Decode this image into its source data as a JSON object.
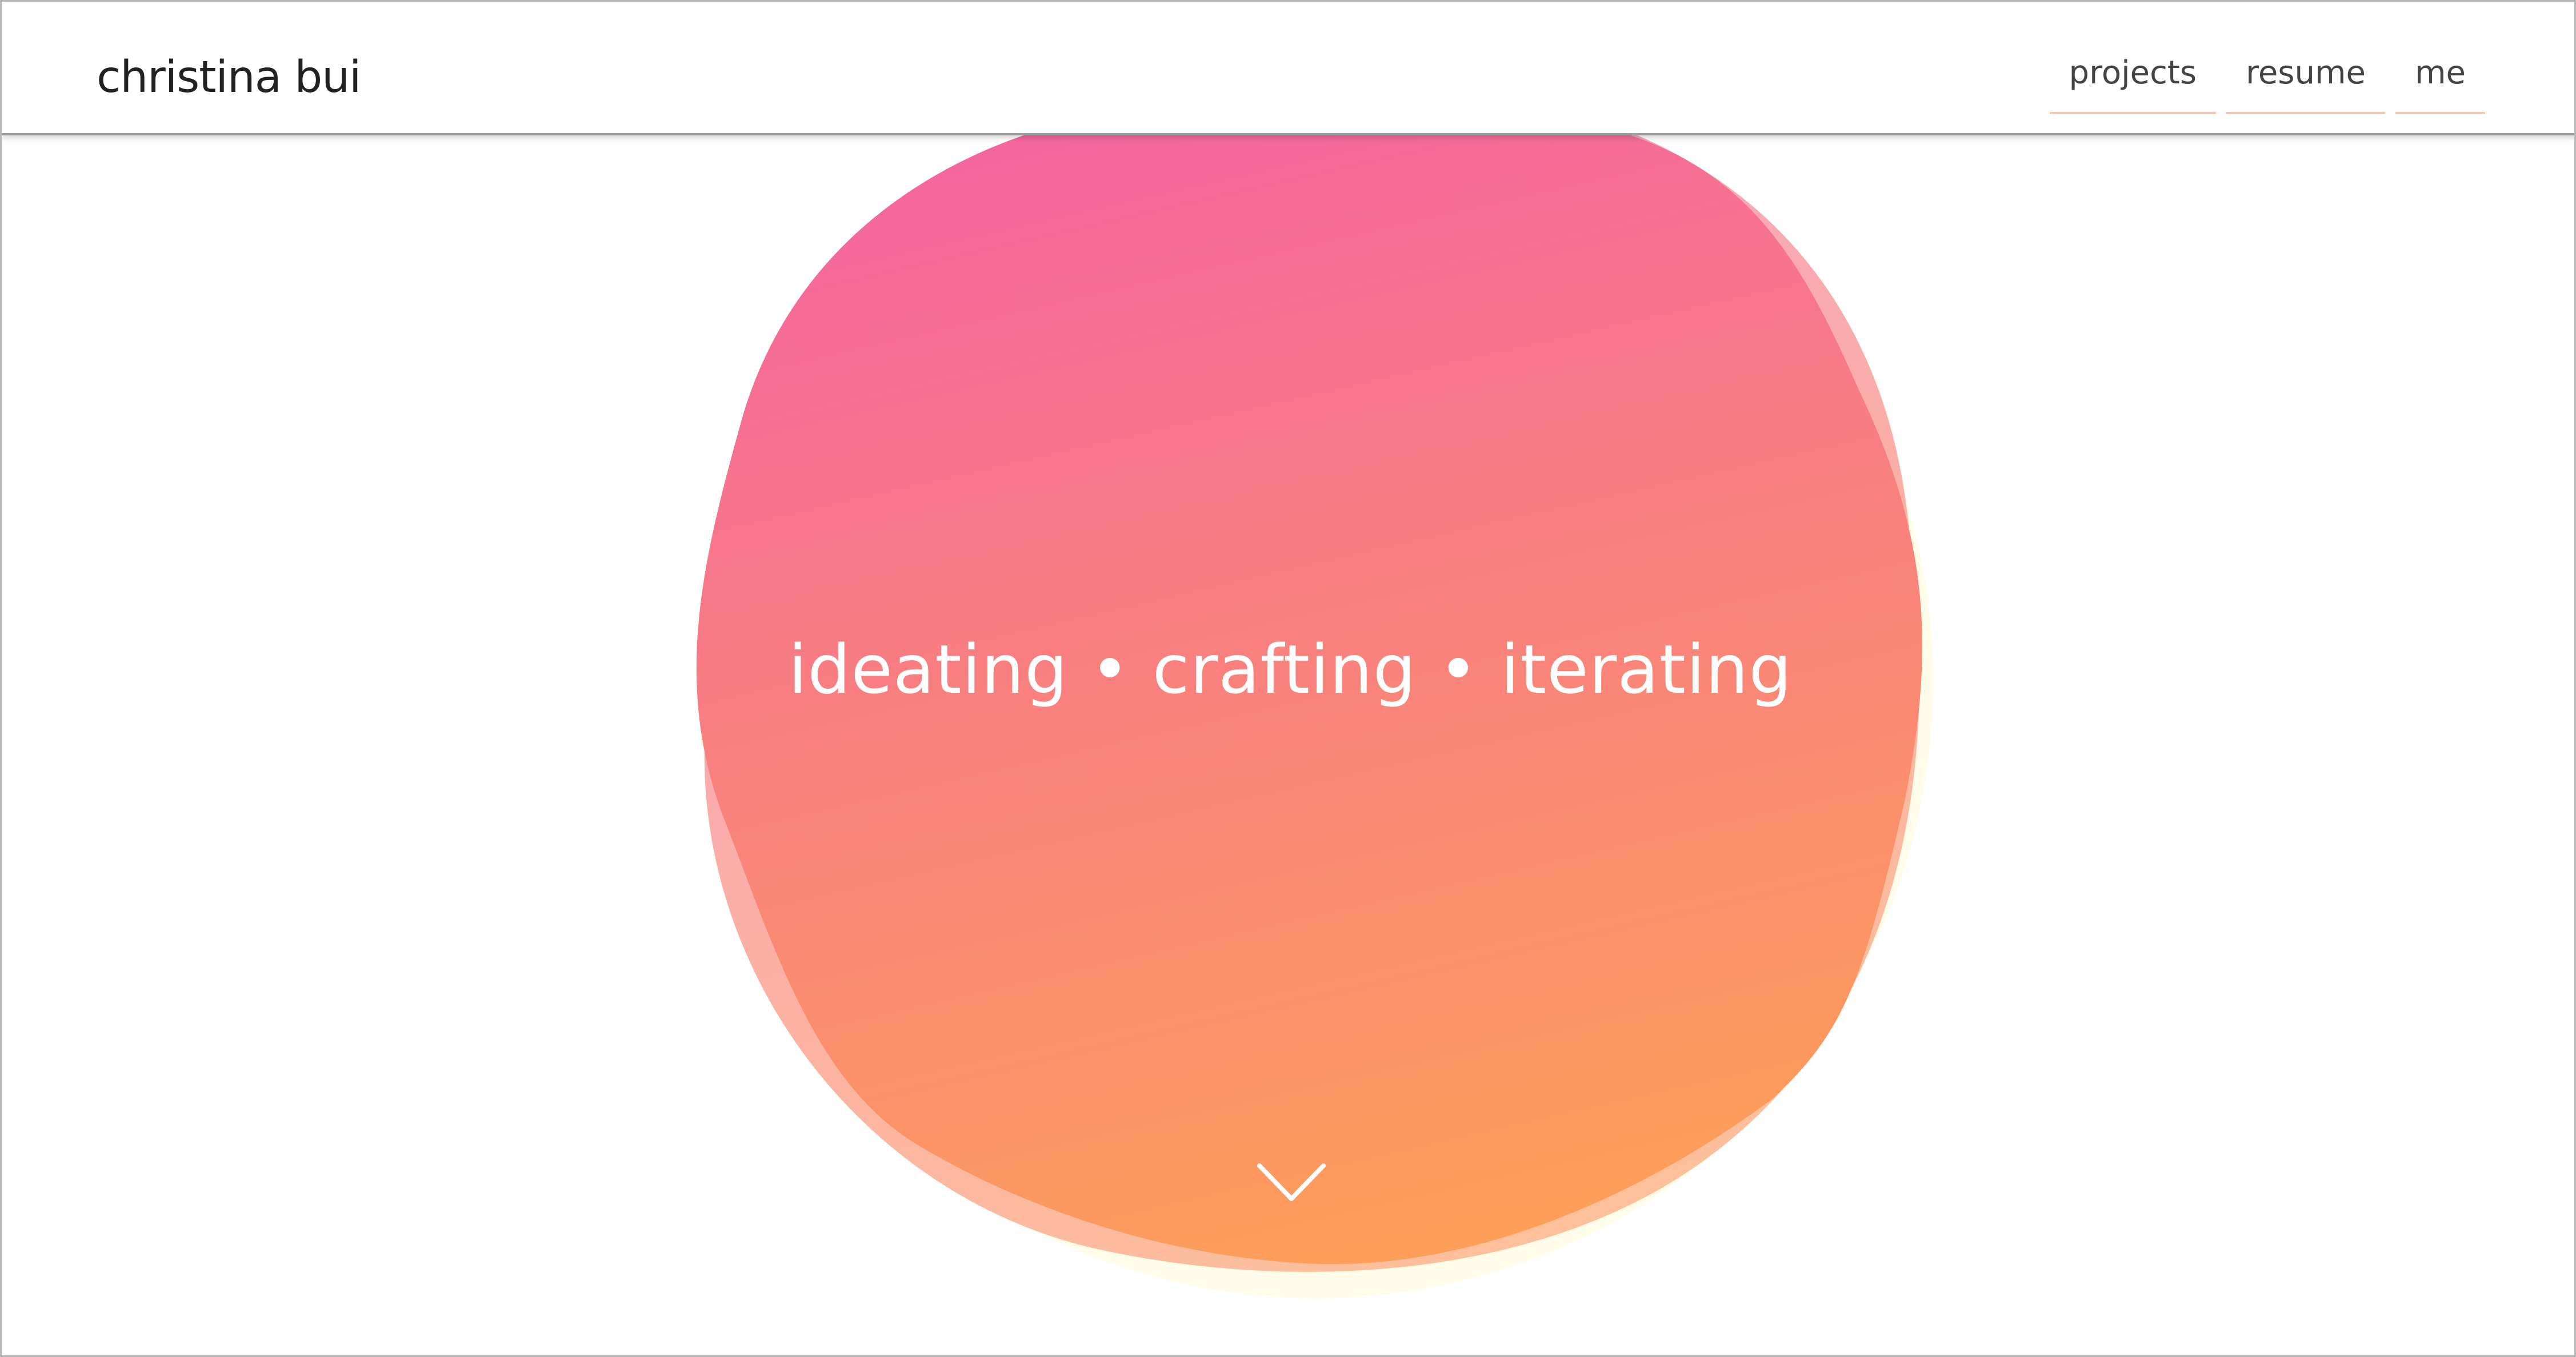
{
  "header": {
    "brand": "christina bui",
    "nav": [
      {
        "label": "projects"
      },
      {
        "label": "resume"
      },
      {
        "label": "me"
      }
    ]
  },
  "hero": {
    "tagline": "ideating • crafting • iterating",
    "scroll_icon": "chevron-down-icon",
    "colors": {
      "gradient_top": "#f4669f",
      "gradient_bottom": "#fe9f58",
      "back_blob_pink": "#f5a1c5",
      "back_blob_peach": "#fdc19a",
      "back_blob_cream": "#fffde9"
    }
  }
}
